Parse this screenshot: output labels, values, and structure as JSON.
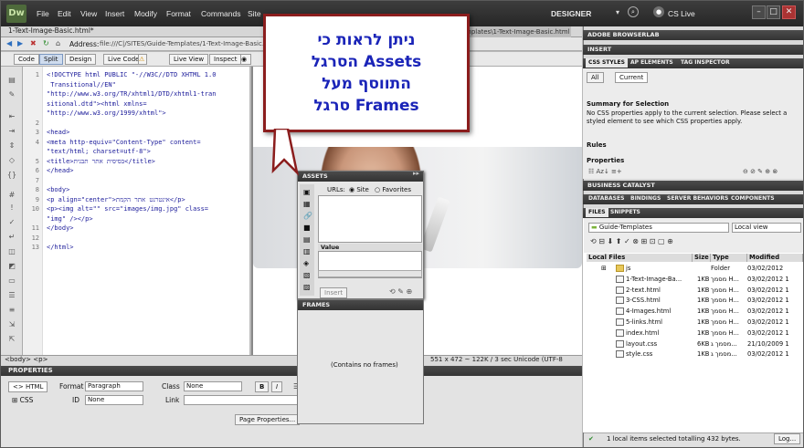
{
  "app": {
    "logo": "Dw"
  },
  "menubar": {
    "items": [
      "File",
      "Edit",
      "View",
      "Insert",
      "Modify",
      "Format",
      "Commands",
      "Site"
    ],
    "workspace": "DESIGNER",
    "cslive": "CS Live"
  },
  "document": {
    "tab": "1-Text-Image-Basic.html*",
    "path_right": "mplates\\1-Text-Image-Basic.html",
    "address_label": "Address:",
    "address_value": "file:///C|/SITES/Guide-Templates/1-Text-Image-Basic.htm"
  },
  "toolbar": {
    "code": "Code",
    "split": "Split",
    "design": "Design",
    "live_code": "Live Code",
    "live_view": "Live View",
    "inspect": "Inspect"
  },
  "code_lines": [
    {
      "n": "1",
      "t": "<!DOCTYPE html PUBLIC \"-//W3C//DTD XHTML 1.0"
    },
    {
      "n": "",
      "t": " Transitional//EN\""
    },
    {
      "n": "",
      "t": "\"http://www.w3.org/TR/xhtml1/DTD/xhtml1-tran"
    },
    {
      "n": "",
      "t": "sitional.dtd\"><html xmlns="
    },
    {
      "n": "",
      "t": "\"http://www.w3.org/1999/xhtml\">"
    },
    {
      "n": "2",
      "t": ""
    },
    {
      "n": "3",
      "t": "<head>"
    },
    {
      "n": "4",
      "t": "<meta http-equiv=\"Content-Type\" content="
    },
    {
      "n": "",
      "t": "\"text/html; charset=utf-8\">"
    },
    {
      "n": "5",
      "t": "<title>בסיסית אתר תבנית</title>"
    },
    {
      "n": "6",
      "t": "</head>"
    },
    {
      "n": "7",
      "t": ""
    },
    {
      "n": "8",
      "t": "<body>"
    },
    {
      "n": "9",
      "t": "<p align=\"center\">אינטרנט אתר הקמת</p>"
    },
    {
      "n": "10",
      "t": "<p><img alt=\"\" src=\"images/img.jpg\" class="
    },
    {
      "n": "",
      "t": "\"img\" /></p>"
    },
    {
      "n": "11",
      "t": "</body>"
    },
    {
      "n": "12",
      "t": ""
    },
    {
      "n": "13",
      "t": "</html>"
    }
  ],
  "statusbar": {
    "tag_selector": "<body> <p>",
    "right": "551 x 472 ~   122K / 3 sec  Unicode (UTF-8"
  },
  "properties": {
    "title": "PROPERTIES",
    "html": "HTML",
    "css": "CSS",
    "format_label": "Format",
    "format_value": "Paragraph",
    "id_label": "ID",
    "id_value": "None",
    "class_label": "Class",
    "class_value": "None",
    "link_label": "Link",
    "bold": "B",
    "italic": "I",
    "page_properties": "Page Properties..."
  },
  "right_panels": {
    "browserlab": "ADOBE BROWSERLAB",
    "insert": "INSERT",
    "css_tabs": [
      "CSS STYLES",
      "AP ELEMENTS",
      "TAG INSPECTOR"
    ],
    "css_buttons": [
      "All",
      "Current"
    ],
    "summary_title": "Summary for Selection",
    "summary_text": "No CSS properties apply to the current selection.  Please select a styled element to see which CSS properties apply.",
    "rules": "Rules",
    "props": "Properties",
    "business": "BUSINESS CATALYST",
    "db_tabs": [
      "DATABASES",
      "BINDINGS",
      "SERVER BEHAVIORS",
      "COMPONENTS"
    ],
    "files_tabs": [
      "FILES",
      "SNIPPETS"
    ],
    "site": "Guide-Templates",
    "view": "Local view",
    "columns": [
      "Local Files",
      "Size",
      "Type",
      "Modified"
    ],
    "files": [
      {
        "name": "js",
        "size": "",
        "type": "Folder",
        "mod": "03/02/2012"
      },
      {
        "name": "1-Text-Image-Ba...",
        "size": "1KB",
        "type": "מסמך H...",
        "mod": "03/02/2012 1"
      },
      {
        "name": "2-text.html",
        "size": "1KB",
        "type": "מסמך H...",
        "mod": "03/02/2012 1"
      },
      {
        "name": "3-CSS.html",
        "size": "1KB",
        "type": "מסמך H...",
        "mod": "03/02/2012 1"
      },
      {
        "name": "4-Images.html",
        "size": "1KB",
        "type": "מסמך H...",
        "mod": "03/02/2012 1"
      },
      {
        "name": "5-links.html",
        "size": "1KB",
        "type": "מסמך H...",
        "mod": "03/02/2012 1"
      },
      {
        "name": "index.html",
        "size": "1KB",
        "type": "מסמך H...",
        "mod": "03/02/2012 1"
      },
      {
        "name": "layout.css",
        "size": "6KB",
        "type": "מסמך ג...",
        "mod": "21/10/2009 1"
      },
      {
        "name": "style.css",
        "size": "1KB",
        "type": "מסמך ג...",
        "mod": "03/02/2012 1"
      }
    ],
    "status": "1 local items selected totalling 432 bytes.",
    "log": "Log..."
  },
  "assets": {
    "title": "ASSETS",
    "urls": "URLs:",
    "site": "Site",
    "favorites": "Favorites",
    "value": "Value",
    "insert": "Insert"
  },
  "frames": {
    "title": "FRAMES",
    "empty": "(Contains no frames)"
  },
  "callout": {
    "lines": [
      "ניתן לראות כי",
      "הסרגל Assets",
      "התווסף מעל",
      "סרגל Frames"
    ]
  },
  "colors": {
    "callout_border": "#8b1d1d",
    "callout_text": "#1a24b8"
  }
}
